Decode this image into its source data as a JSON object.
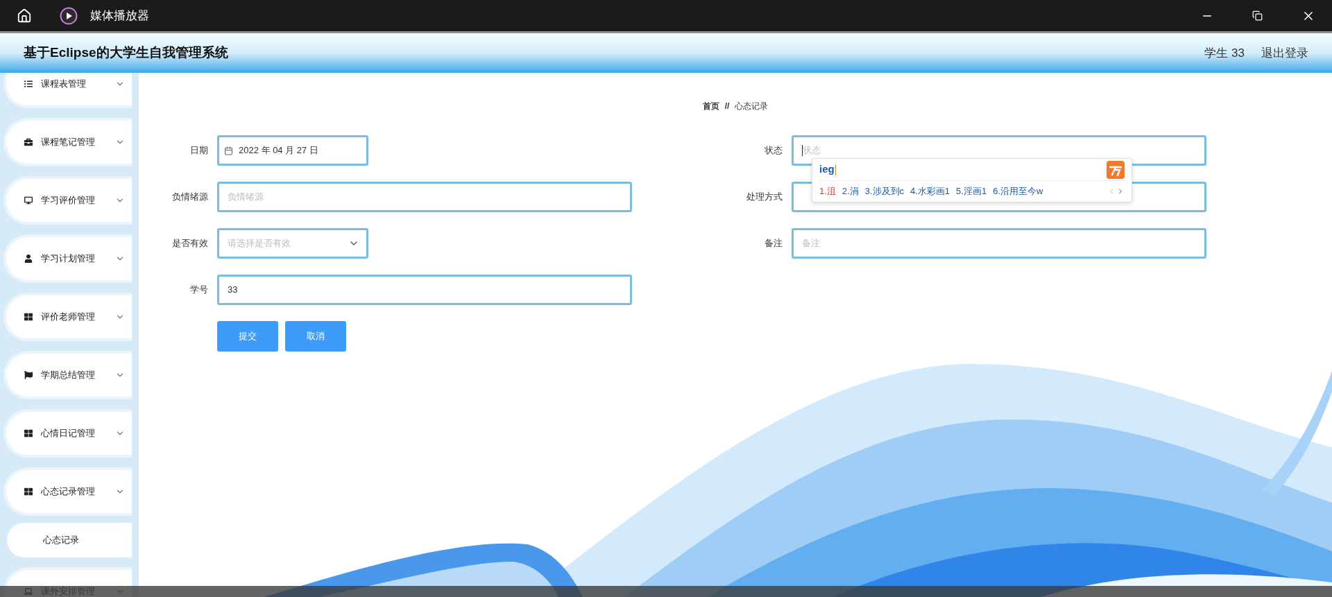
{
  "title_bar": {
    "title": "媒体播放器"
  },
  "header": {
    "title": "基于Eclipse的大学生自我管理系统",
    "user": "学生 33",
    "logout": "退出登录"
  },
  "sidebar": {
    "items": [
      {
        "label": "课程表管理",
        "kind": "list"
      },
      {
        "label": "课程笔记管理",
        "kind": "briefcase"
      },
      {
        "label": "学习评价管理",
        "kind": "monitor"
      },
      {
        "label": "学习计划管理",
        "kind": "user"
      },
      {
        "label": "评价老师管理",
        "kind": "grid"
      },
      {
        "label": "学期总结管理",
        "kind": "flag"
      },
      {
        "label": "心情日记管理",
        "kind": "grid"
      },
      {
        "label": "心态记录管理",
        "kind": "grid",
        "children": [
          {
            "label": "心态记录"
          }
        ]
      },
      {
        "label": "课外安排管理",
        "kind": "laptop"
      }
    ]
  },
  "breadcrumb": {
    "items": [
      "首页",
      "心态记录"
    ],
    "separator": "//"
  },
  "form": {
    "left": [
      {
        "kind": "date",
        "label": "日期",
        "value": "2022 年 04 月 27 日"
      },
      {
        "kind": "text",
        "label": "负情绪源",
        "placeholder": "负情绪源"
      },
      {
        "kind": "select",
        "label": "是否有效",
        "placeholder": "请选择是否有效"
      },
      {
        "kind": "text",
        "label": "学号",
        "value": "33"
      }
    ],
    "right": [
      {
        "kind": "text",
        "label": "状态",
        "placeholder": "状态",
        "focused": true
      },
      {
        "kind": "text",
        "label": "处理方式",
        "focused": false
      },
      {
        "kind": "text",
        "label": "备注",
        "placeholder": "备注",
        "focused": false
      }
    ],
    "buttons": [
      "提交",
      "取消"
    ]
  },
  "ime": {
    "input": "ieg",
    "candidates": [
      {
        "text": "1.沮",
        "selected": true
      },
      {
        "text": "2.涓",
        "selected": false
      },
      {
        "text": "3.涉及到c",
        "selected": false
      },
      {
        "text": "4.水彩画1",
        "selected": false
      },
      {
        "text": "5.淫画1",
        "selected": false
      },
      {
        "text": "6.沿用至今w",
        "selected": false
      }
    ]
  }
}
